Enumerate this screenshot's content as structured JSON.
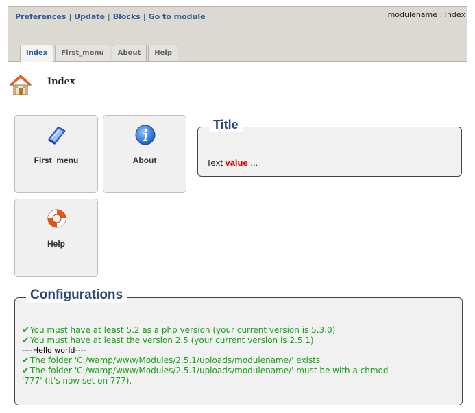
{
  "nav": {
    "links": [
      "Preferences",
      "Update",
      "Blocks",
      "Go to module"
    ],
    "module_label": "modulename : Index",
    "tabs": [
      "Index",
      "First_menu",
      "About",
      "Help"
    ],
    "active_tab": "Index"
  },
  "page": {
    "title": "Index"
  },
  "shortcuts": {
    "first_menu": "First_menu",
    "about": "About",
    "help": "Help"
  },
  "title_box": {
    "legend": "Title",
    "text_prefix": "Text ",
    "text_value": "value",
    "text_suffix": " ..."
  },
  "config": {
    "legend": "Configurations",
    "line1": "You must have at least 5.2 as a php version (your current version is 5.3.0)",
    "line2": "You must have at least the version 2.5 (your current version is 2.5.1)",
    "line3": "----Hello world----",
    "line4": "The folder 'C:/wamp/www/Modules/2.5.1/uploads/modulename/' exists",
    "line5a": "The folder 'C:/wamp/www/Modules/2.5.1/uploads/modulename/' must be with a chmod",
    "line5b": "'777' (it's now set on 777)."
  },
  "colors": {
    "link": "#2f5a9c",
    "legend": "#284775",
    "ok": "#13a313",
    "value": "#e00000"
  }
}
